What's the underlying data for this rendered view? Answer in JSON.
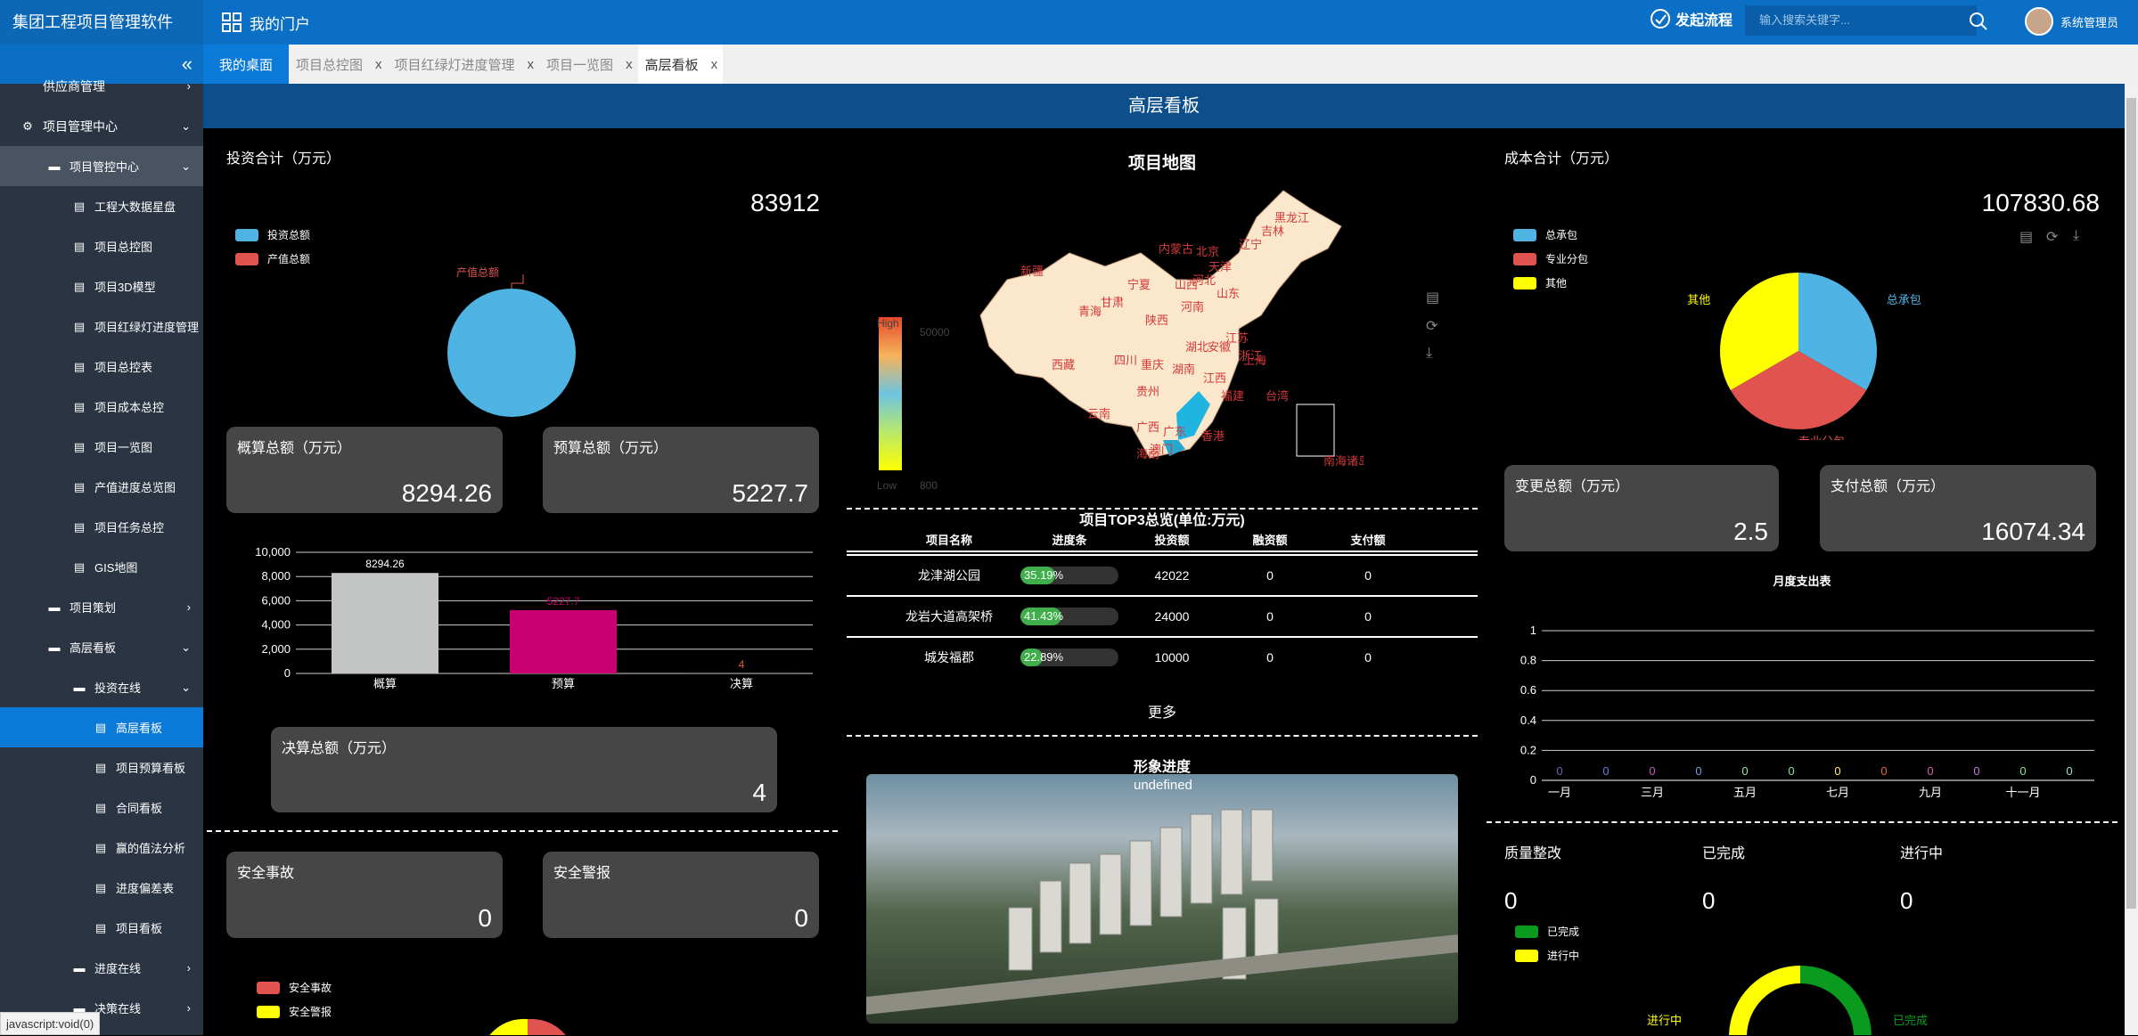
{
  "app": {
    "title": "集团工程项目管理软件",
    "portal": "我的门户",
    "flow": "发起流程",
    "search_placeholder": "输入搜索关键字...",
    "user": "系统管理员",
    "status_bar": "javascript:void(0)"
  },
  "sidebar": {
    "items": [
      {
        "label": "供应商管理",
        "level": "l1",
        "chev": "›"
      },
      {
        "label": "项目管理中心",
        "level": "l1",
        "chev": "⌄",
        "icon": "gear"
      },
      {
        "label": "项目管控中心",
        "level": "l2",
        "chev": "⌄",
        "icon": "folder",
        "hl": true
      },
      {
        "label": "工程大数据星盘",
        "level": "l3",
        "icon": "doc"
      },
      {
        "label": "项目总控图",
        "level": "l3",
        "icon": "doc"
      },
      {
        "label": "项目3D模型",
        "level": "l3",
        "icon": "doc"
      },
      {
        "label": "项目红绿灯进度管理",
        "level": "l3",
        "icon": "doc"
      },
      {
        "label": "项目总控表",
        "level": "l3",
        "icon": "doc"
      },
      {
        "label": "项目成本总控",
        "level": "l3",
        "icon": "doc"
      },
      {
        "label": "项目一览图",
        "level": "l3",
        "icon": "doc"
      },
      {
        "label": "产值进度总览图",
        "level": "l3",
        "icon": "doc"
      },
      {
        "label": "项目任务总控",
        "level": "l3",
        "icon": "doc"
      },
      {
        "label": "GIS地图",
        "level": "l3",
        "icon": "doc"
      },
      {
        "label": "项目策划",
        "level": "l2",
        "chev": "›",
        "icon": "folder"
      },
      {
        "label": "高层看板",
        "level": "l2",
        "chev": "⌄",
        "icon": "folder"
      },
      {
        "label": "投资在线",
        "level": "l3",
        "chev": "⌄",
        "icon": "folder"
      },
      {
        "label": "高层看板",
        "level": "l4",
        "icon": "doc",
        "active": true
      },
      {
        "label": "项目预算看板",
        "level": "l4",
        "icon": "doc"
      },
      {
        "label": "合同看板",
        "level": "l4",
        "icon": "doc"
      },
      {
        "label": "赢的值法分析",
        "level": "l4",
        "icon": "doc"
      },
      {
        "label": "进度偏差表",
        "level": "l4",
        "icon": "doc"
      },
      {
        "label": "项目看板",
        "level": "l4",
        "icon": "doc"
      },
      {
        "label": "进度在线",
        "level": "l3",
        "chev": "›",
        "icon": "folder"
      },
      {
        "label": "决策在线",
        "level": "l3",
        "chev": "›",
        "icon": "folder"
      }
    ]
  },
  "tabs": [
    {
      "label": "我的桌面",
      "type": "home"
    },
    {
      "label": "项目总控图",
      "close": "x"
    },
    {
      "label": "项目红绿灯进度管理",
      "close": "x"
    },
    {
      "label": "项目一览图",
      "close": "x"
    },
    {
      "label": "高层看板",
      "close": "x",
      "current": true
    }
  ],
  "dashboard_title": "高层看板",
  "invest": {
    "title": "投资合计（万元）",
    "total": "83912",
    "legend": [
      "投资总额",
      "产值总额"
    ],
    "pie_label": "产值总额",
    "card1": {
      "label": "概算总额（万元）",
      "value": "8294.26"
    },
    "card2": {
      "label": "预算总额（万元）",
      "value": "5227.7"
    },
    "card3": {
      "label": "决算总额（万元）",
      "value": "4"
    }
  },
  "safety": {
    "card1": {
      "label": "安全事故",
      "value": "0"
    },
    "card2": {
      "label": "安全警报",
      "value": "0"
    },
    "legend": [
      "安全事故",
      "安全警报"
    ]
  },
  "map": {
    "title": "项目地图",
    "high": "High",
    "low": "Low",
    "max": "50000",
    "min": "800",
    "provinces": [
      "新疆",
      "西藏",
      "青海",
      "甘肃",
      "四川",
      "云南",
      "宁夏",
      "陕西",
      "内蒙古",
      "山西",
      "河北",
      "北京",
      "天津",
      "辽宁",
      "吉林",
      "黑龙江",
      "山东",
      "河南",
      "湖北",
      "重庆",
      "贵州",
      "湖南",
      "广西",
      "广东",
      "江西",
      "福建",
      "浙江",
      "安徽",
      "江苏",
      "上海",
      "海南",
      "台湾",
      "香港",
      "澳门",
      "南海诸岛"
    ]
  },
  "top3": {
    "title": "项目TOP3总览(单位:万元)",
    "headers": [
      "项目名称",
      "进度条",
      "投资额",
      "融资额",
      "支付额"
    ],
    "rows": [
      [
        "龙津湖公园",
        "35.19%",
        "42022",
        "0",
        "0"
      ],
      [
        "龙岩大道高架桥",
        "41.43%",
        "24000",
        "0",
        "0"
      ],
      [
        "城发福郡",
        "22.89%",
        "10000",
        "0",
        "0"
      ]
    ],
    "more": "更多"
  },
  "image": {
    "title": "形象进度",
    "alt": "undefined"
  },
  "cost": {
    "title": "成本合计（万元）",
    "total": "107830.68",
    "legend": [
      "总承包",
      "专业分包",
      "其他"
    ],
    "card1": {
      "label": "变更总额（万元）",
      "value": "2.5"
    },
    "card2": {
      "label": "支付总额（万元）",
      "value": "16074.34"
    },
    "monthly_title": "月度支出表"
  },
  "quality": {
    "title": "质量整改",
    "done": "已完成",
    "doing": "进行中",
    "v1": "0",
    "v2": "0",
    "v3": "0"
  },
  "chart_data": [
    {
      "type": "pie",
      "name": "investment",
      "categories": [
        "投资总额",
        "产值总额"
      ],
      "values": [
        83912,
        0
      ],
      "colors": [
        "#4fb3e4",
        "#e0534f"
      ]
    },
    {
      "type": "bar",
      "categories": [
        "概算",
        "预算",
        "决算"
      ],
      "values": [
        8294.26,
        5227.7,
        4
      ],
      "colors": [
        "#c3c5c5",
        "#c8006f",
        "#e45b3a"
      ],
      "ylim": [
        0,
        10000
      ],
      "yticks": [
        "0",
        "2,000",
        "4,000",
        "6,000",
        "8,000",
        "10,000"
      ]
    },
    {
      "type": "pie",
      "name": "cost",
      "categories": [
        "总承包",
        "专业分包",
        "其他"
      ],
      "values": [
        35937,
        35937,
        35956
      ],
      "colors": [
        "#4fb3e4",
        "#e0534f",
        "#ffff00"
      ]
    },
    {
      "type": "line",
      "title": "月度支出表",
      "categories": [
        "一月",
        "二月",
        "三月",
        "四月",
        "五月",
        "六月",
        "七月",
        "八月",
        "九月",
        "十月",
        "十一月",
        "十二月"
      ],
      "xticks": [
        "一月",
        "三月",
        "五月",
        "七月",
        "九月",
        "十一月"
      ],
      "values": [
        0,
        0,
        0,
        0,
        0,
        0,
        0,
        0,
        0,
        0,
        0,
        0
      ],
      "ylim": [
        0,
        1
      ],
      "yticks": [
        "0",
        "0.2",
        "0.4",
        "0.6",
        "0.8",
        "1"
      ]
    },
    {
      "type": "pie",
      "name": "quality",
      "categories": [
        "已完成",
        "进行中"
      ],
      "values": [
        1,
        1
      ],
      "colors": [
        "#0a9a1e",
        "#ffff00"
      ]
    }
  ]
}
